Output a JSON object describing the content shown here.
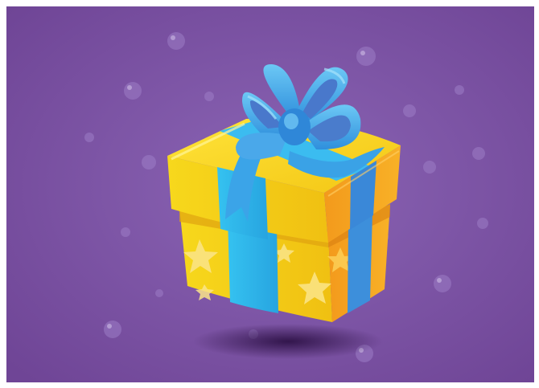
{
  "scene": {
    "subject": "gift-box",
    "colors": {
      "background_outer": "#7a4fa0",
      "background_center": "#8a63b3",
      "bubble": "#9a78c2",
      "box_yellow": "#f5d21c",
      "box_yellow_dark": "#e8b610",
      "box_orange": "#f29a1e",
      "ribbon_blue": "#2fb7ea",
      "ribbon_blue_dark": "#2b86d3",
      "bow_blue": "#3fa2e6",
      "bow_inner": "#4a79c9",
      "star": "#fbe68a",
      "shadow": "#3d1f5c"
    },
    "icons": [
      "gift-box-icon",
      "bow-icon",
      "star-icon",
      "bubble-icon"
    ]
  }
}
